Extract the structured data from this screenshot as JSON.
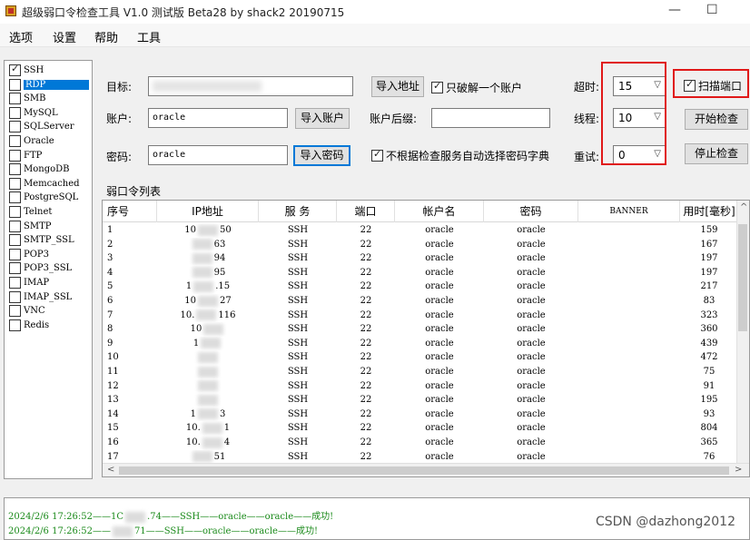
{
  "window": {
    "title": "超级弱口令检查工具 V1.0 测试版 Beta28 by shack2 20190715",
    "minimize": "—",
    "maximize": "☐"
  },
  "menu": [
    "选项",
    "设置",
    "帮助",
    "工具"
  ],
  "protocols": [
    {
      "label": "SSH",
      "checked": true,
      "selected": false
    },
    {
      "label": "RDP",
      "checked": false,
      "selected": true
    },
    {
      "label": "SMB",
      "checked": false,
      "selected": false
    },
    {
      "label": "MySQL",
      "checked": false,
      "selected": false
    },
    {
      "label": "SQLServer",
      "checked": false,
      "selected": false
    },
    {
      "label": "Oracle",
      "checked": false,
      "selected": false
    },
    {
      "label": "FTP",
      "checked": false,
      "selected": false
    },
    {
      "label": "MongoDB",
      "checked": false,
      "selected": false
    },
    {
      "label": "Memcached",
      "checked": false,
      "selected": false
    },
    {
      "label": "PostgreSQL",
      "checked": false,
      "selected": false
    },
    {
      "label": "Telnet",
      "checked": false,
      "selected": false
    },
    {
      "label": "SMTP",
      "checked": false,
      "selected": false
    },
    {
      "label": "SMTP_SSL",
      "checked": false,
      "selected": false
    },
    {
      "label": "POP3",
      "checked": false,
      "selected": false
    },
    {
      "label": "POP3_SSL",
      "checked": false,
      "selected": false
    },
    {
      "label": "IMAP",
      "checked": false,
      "selected": false
    },
    {
      "label": "IMAP_SSL",
      "checked": false,
      "selected": false
    },
    {
      "label": "VNC",
      "checked": false,
      "selected": false
    },
    {
      "label": "Redis",
      "checked": false,
      "selected": false
    }
  ],
  "settings": {
    "target_label": "目标:",
    "target_value": "",
    "import_address": "导入地址",
    "only_one_account": "只破解一个账户",
    "only_one_account_checked": true,
    "account_label": "账户:",
    "account_value": "oracle",
    "import_account": "导入账户",
    "account_suffix_label": "账户后缀:",
    "account_suffix_value": "",
    "password_label": "密码:",
    "password_value": "oracle",
    "import_password": "导入密码",
    "no_auto_dict": "不根据检查服务自动选择密码字典",
    "no_auto_dict_checked": true,
    "timeout_label": "超时:",
    "timeout_value": "15",
    "threads_label": "线程:",
    "threads_value": "10",
    "retry_label": "重试:",
    "retry_value": "0",
    "scan_port": "扫描端口",
    "scan_port_checked": true,
    "start_check": "开始检查",
    "stop_check": "停止检查",
    "highlight_color": "#e01818",
    "focus_color": "#0078d7"
  },
  "grid": {
    "title": "弱口令列表",
    "columns": [
      "序号",
      "IP地址",
      "服 务",
      "端口",
      "帐户名",
      "密码",
      "BANNER",
      "用时[毫秒]"
    ],
    "rows": [
      {
        "no": "1",
        "ip_a": "10",
        "ip_b": "50",
        "service": "SSH",
        "port": "22",
        "user": "oracle",
        "password": "oracle",
        "banner": "",
        "time": "159"
      },
      {
        "no": "2",
        "ip_a": "",
        "ip_b": "63",
        "service": "SSH",
        "port": "22",
        "user": "oracle",
        "password": "oracle",
        "banner": "",
        "time": "167"
      },
      {
        "no": "3",
        "ip_a": "",
        "ip_b": "94",
        "service": "SSH",
        "port": "22",
        "user": "oracle",
        "password": "oracle",
        "banner": "",
        "time": "197"
      },
      {
        "no": "4",
        "ip_a": "",
        "ip_b": "95",
        "service": "SSH",
        "port": "22",
        "user": "oracle",
        "password": "oracle",
        "banner": "",
        "time": "197"
      },
      {
        "no": "5",
        "ip_a": "1",
        "ip_b": ".15",
        "service": "SSH",
        "port": "22",
        "user": "oracle",
        "password": "oracle",
        "banner": "",
        "time": "217"
      },
      {
        "no": "6",
        "ip_a": "10",
        "ip_b": "27",
        "service": "SSH",
        "port": "22",
        "user": "oracle",
        "password": "oracle",
        "banner": "",
        "time": "83"
      },
      {
        "no": "7",
        "ip_a": "10.",
        "ip_b": "116",
        "service": "SSH",
        "port": "22",
        "user": "oracle",
        "password": "oracle",
        "banner": "",
        "time": "323"
      },
      {
        "no": "8",
        "ip_a": "10",
        "ip_b": "",
        "service": "SSH",
        "port": "22",
        "user": "oracle",
        "password": "oracle",
        "banner": "",
        "time": "360"
      },
      {
        "no": "9",
        "ip_a": "1",
        "ip_b": "",
        "service": "SSH",
        "port": "22",
        "user": "oracle",
        "password": "oracle",
        "banner": "",
        "time": "439"
      },
      {
        "no": "10",
        "ip_a": "",
        "ip_b": "",
        "service": "SSH",
        "port": "22",
        "user": "oracle",
        "password": "oracle",
        "banner": "",
        "time": "472"
      },
      {
        "no": "11",
        "ip_a": "",
        "ip_b": "",
        "service": "SSH",
        "port": "22",
        "user": "oracle",
        "password": "oracle",
        "banner": "",
        "time": "75"
      },
      {
        "no": "12",
        "ip_a": "",
        "ip_b": "",
        "service": "SSH",
        "port": "22",
        "user": "oracle",
        "password": "oracle",
        "banner": "",
        "time": "91"
      },
      {
        "no": "13",
        "ip_a": "",
        "ip_b": "",
        "service": "SSH",
        "port": "22",
        "user": "oracle",
        "password": "oracle",
        "banner": "",
        "time": "195"
      },
      {
        "no": "14",
        "ip_a": "1",
        "ip_b": "3",
        "service": "SSH",
        "port": "22",
        "user": "oracle",
        "password": "oracle",
        "banner": "",
        "time": "93"
      },
      {
        "no": "15",
        "ip_a": "10.",
        "ip_b": "1",
        "service": "SSH",
        "port": "22",
        "user": "oracle",
        "password": "oracle",
        "banner": "",
        "time": "804"
      },
      {
        "no": "16",
        "ip_a": "10.",
        "ip_b": "4",
        "service": "SSH",
        "port": "22",
        "user": "oracle",
        "password": "oracle",
        "banner": "",
        "time": "365"
      },
      {
        "no": "17",
        "ip_a": "",
        "ip_b": "51",
        "service": "SSH",
        "port": "22",
        "user": "oracle",
        "password": "oracle",
        "banner": "",
        "time": "76"
      }
    ],
    "scroll_left": "<",
    "scroll_right": ">",
    "scroll_up": "^"
  },
  "log": [
    {
      "time": "2024/2/6 17:26:52",
      "ip_a": "1C",
      "ip_b": ".74",
      "service": "SSH",
      "user": "oracle",
      "password": "oracle",
      "result": "成功!"
    },
    {
      "time": "2024/2/6 17:26:52",
      "ip_a": "",
      "ip_b": "71",
      "service": "SSH",
      "user": "oracle",
      "password": "oracle",
      "result": "成功!"
    }
  ],
  "watermark": "CSDN @dazhong2012"
}
